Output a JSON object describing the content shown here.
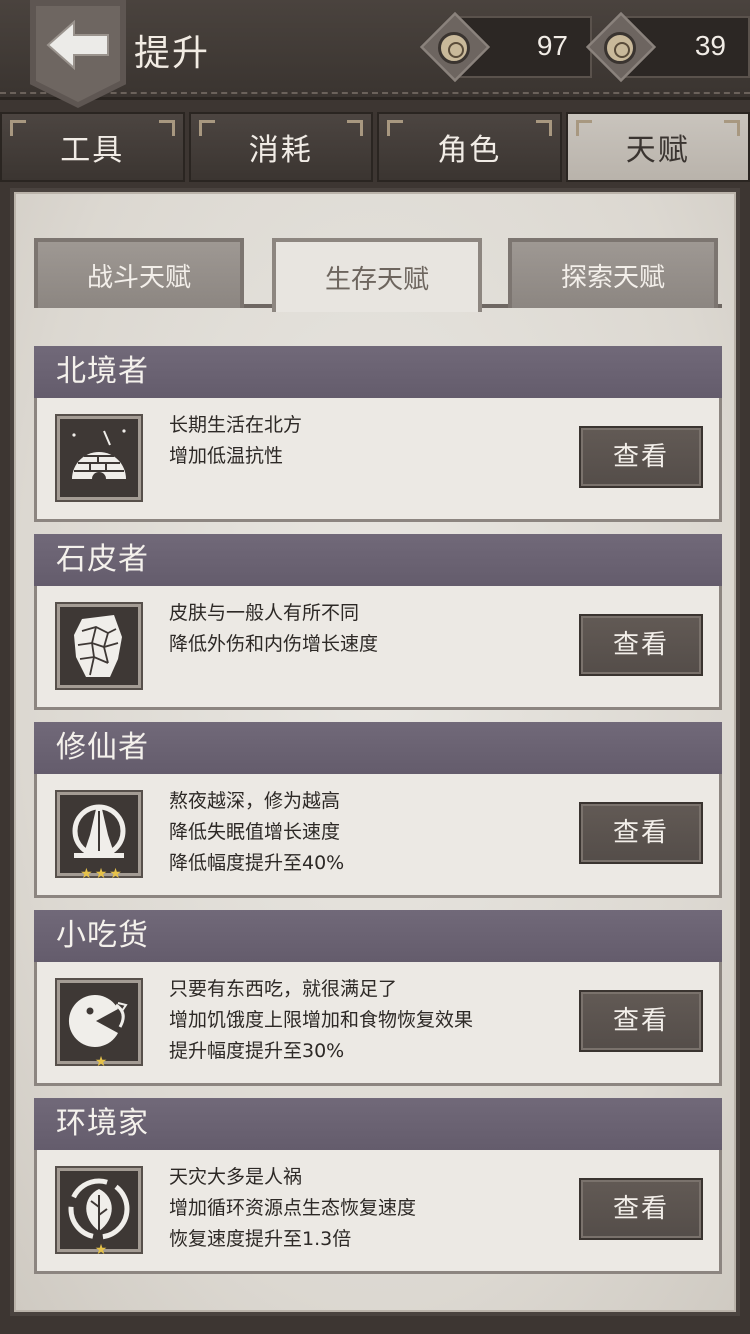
{
  "header": {
    "title": "提升",
    "back_icon": "back-arrow-icon",
    "currencies": [
      {
        "icon": "coin-icon",
        "value": "97"
      },
      {
        "icon": "coin-icon",
        "value": "39"
      }
    ]
  },
  "main_tabs": [
    {
      "label": "工具",
      "active": false
    },
    {
      "label": "消耗",
      "active": false
    },
    {
      "label": "角色",
      "active": false
    },
    {
      "label": "天赋",
      "active": true
    }
  ],
  "sub_tabs": [
    {
      "label": "战斗天赋",
      "active": false
    },
    {
      "label": "生存天赋",
      "active": true
    },
    {
      "label": "探索天赋",
      "active": false
    }
  ],
  "talents": [
    {
      "name": "北境者",
      "icon": "igloo-icon",
      "stars": "",
      "lines": [
        "长期生活在北方",
        "增加低温抗性"
      ],
      "button": "查看"
    },
    {
      "name": "石皮者",
      "icon": "stone-fist-icon",
      "stars": "",
      "lines": [
        "皮肤与一般人有所不同",
        "降低外伤和内伤增长速度"
      ],
      "button": "查看"
    },
    {
      "name": "修仙者",
      "icon": "praying-hands-icon",
      "stars": "★★★",
      "lines": [
        "熬夜越深，修为越高",
        "降低失眠值增长速度",
        "降低幅度提升至40%"
      ],
      "button": "查看"
    },
    {
      "name": "小吃货",
      "icon": "eater-icon",
      "stars": "★",
      "lines": [
        "只要有东西吃，就很满足了",
        "增加饥饿度上限增加和食物恢复效果",
        "提升幅度提升至30%"
      ],
      "button": "查看"
    },
    {
      "name": "环境家",
      "icon": "recycle-leaf-icon",
      "stars": "★",
      "lines": [
        "天灾大多是人祸",
        "增加循环资源点生态恢复速度",
        "恢复速度提升至1.3倍"
      ],
      "button": "查看"
    }
  ]
}
